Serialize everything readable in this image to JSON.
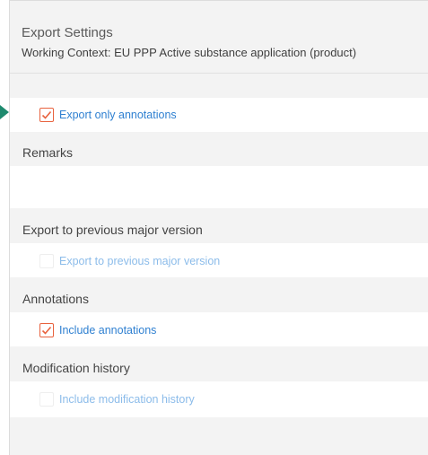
{
  "header": {
    "title": "Export Settings",
    "subtitle": "Working Context: EU PPP Active substance application (product)"
  },
  "export_only_annotations": {
    "label": "Export only annotations",
    "checked": true
  },
  "remarks": {
    "label": "Remarks",
    "value": ""
  },
  "previous_version": {
    "section_label": "Export to previous major version",
    "option_label": "Export to previous major version",
    "checked": false
  },
  "annotations": {
    "section_label": "Annotations",
    "option_label": "Include annotations",
    "checked": true
  },
  "modification_history": {
    "section_label": "Modification history",
    "option_label": "Include modification history",
    "checked": false
  },
  "colors": {
    "accent_check": "#e8623e",
    "link_blue": "#2f80d1",
    "pointer_green": "#1e8a6e"
  }
}
